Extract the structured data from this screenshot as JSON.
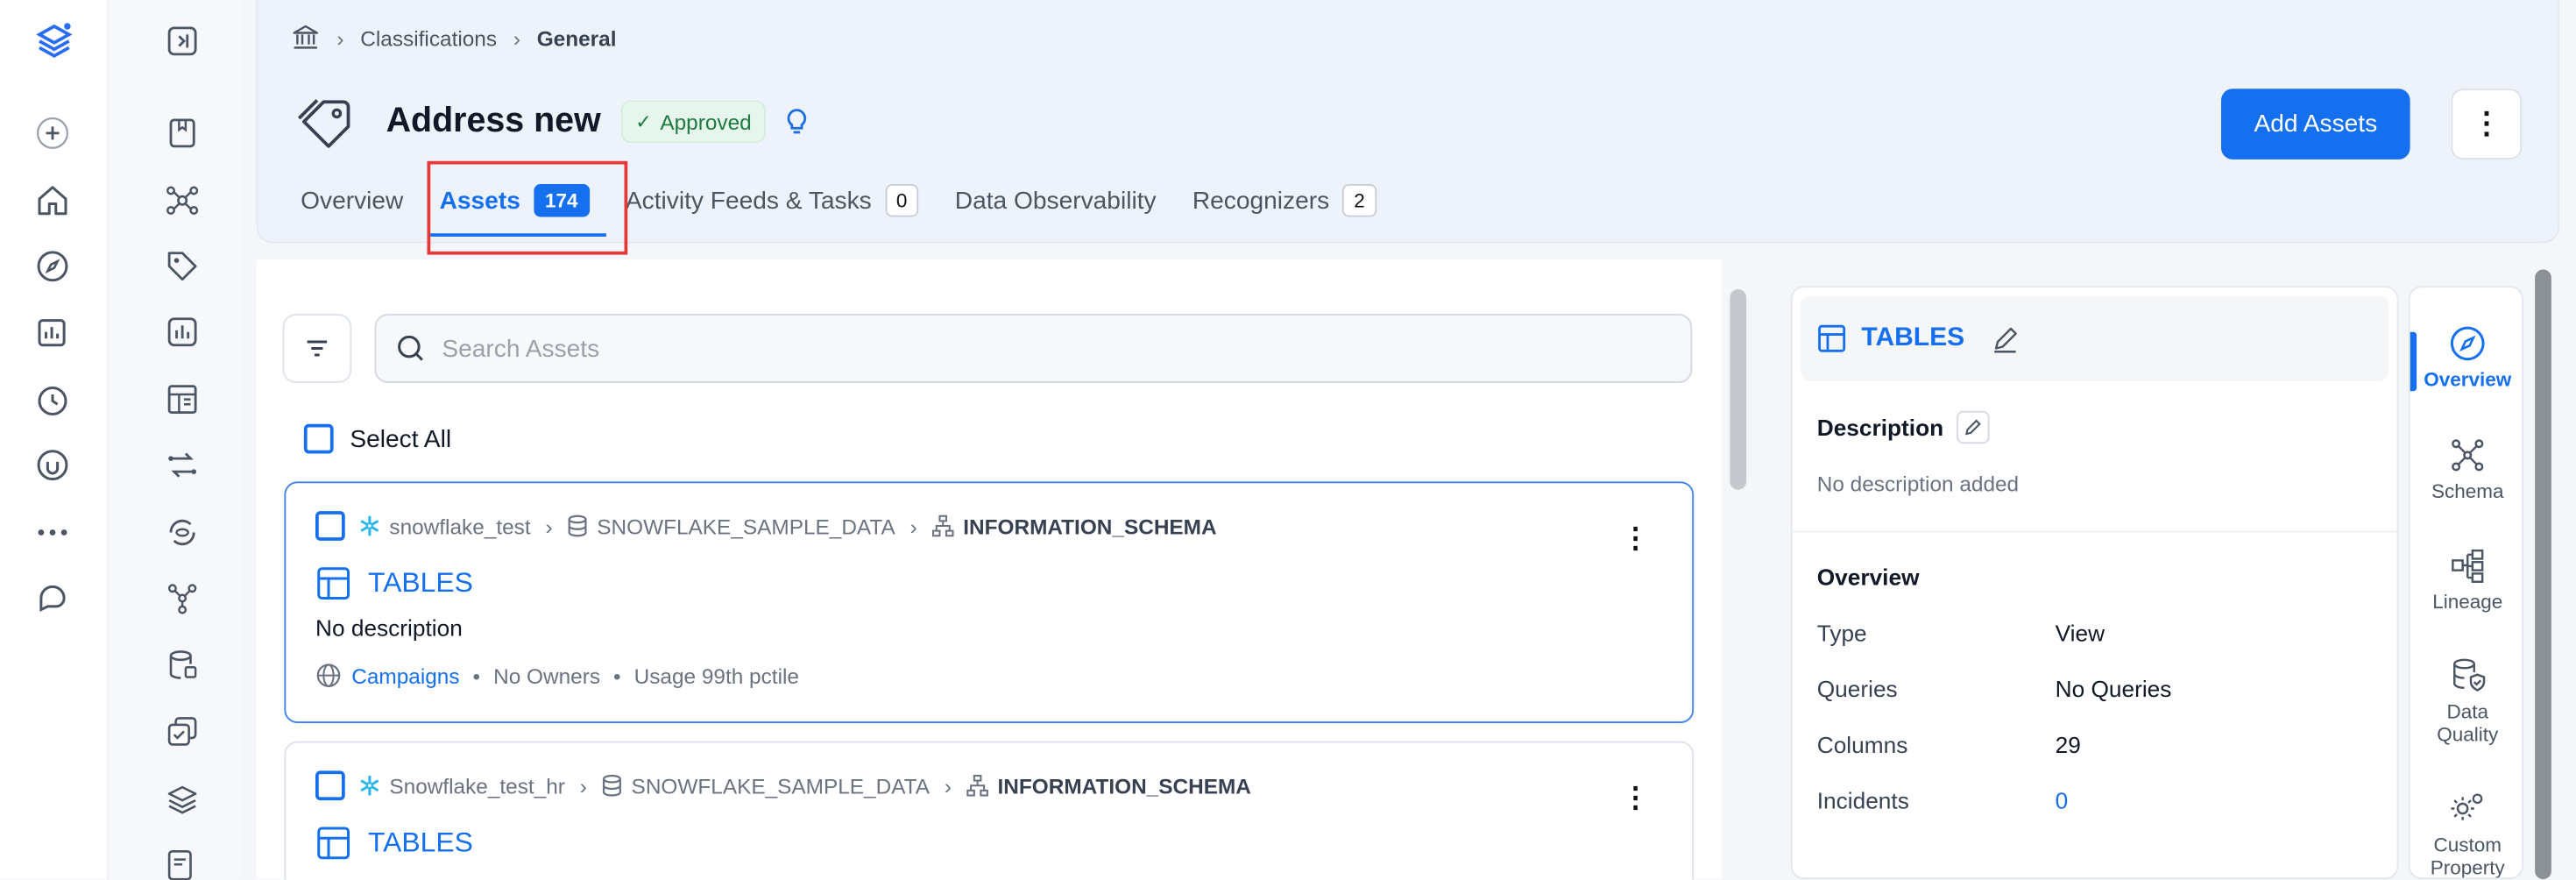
{
  "breadcrumb": {
    "items": [
      "Classifications",
      "General"
    ]
  },
  "header": {
    "title": "Address new",
    "status": "Approved",
    "add_button": "Add Assets",
    "more_label": "⋮"
  },
  "tabs": [
    {
      "label": "Overview",
      "count": null
    },
    {
      "label": "Assets",
      "count": "174"
    },
    {
      "label": "Activity Feeds & Tasks",
      "count": "0"
    },
    {
      "label": "Data Observability",
      "count": null
    },
    {
      "label": "Recognizers",
      "count": "2"
    }
  ],
  "search": {
    "placeholder": "Search Assets"
  },
  "select_all": "Select All",
  "assets": [
    {
      "service": "snowflake_test",
      "database": "SNOWFLAKE_SAMPLE_DATA",
      "schema": "INFORMATION_SCHEMA",
      "name": "TABLES",
      "description": "No description",
      "domain": "Campaigns",
      "owners": "No Owners",
      "usage": "Usage 99th pctile"
    },
    {
      "service": "Snowflake_test_hr",
      "database": "SNOWFLAKE_SAMPLE_DATA",
      "schema": "INFORMATION_SCHEMA",
      "name": "TABLES"
    }
  ],
  "detail": {
    "title": "TABLES",
    "description_label": "Description",
    "description_value": "No description added",
    "overview_label": "Overview",
    "props": [
      {
        "label": "Type",
        "value": "View"
      },
      {
        "label": "Queries",
        "value": "No Queries"
      },
      {
        "label": "Columns",
        "value": "29"
      },
      {
        "label": "Incidents",
        "value": "0"
      }
    ]
  },
  "right_rail": [
    {
      "label": "Overview",
      "icon": "compass-icon"
    },
    {
      "label": "Schema",
      "icon": "schema-icon"
    },
    {
      "label": "Lineage",
      "icon": "lineage-icon"
    },
    {
      "label": "Data Quality",
      "icon": "data-quality-icon"
    },
    {
      "label": "Custom Property",
      "icon": "custom-property-icon"
    }
  ],
  "colors": {
    "accent": "#1570ef",
    "approved": "#1f7a3f",
    "highlight": "#e53935"
  }
}
